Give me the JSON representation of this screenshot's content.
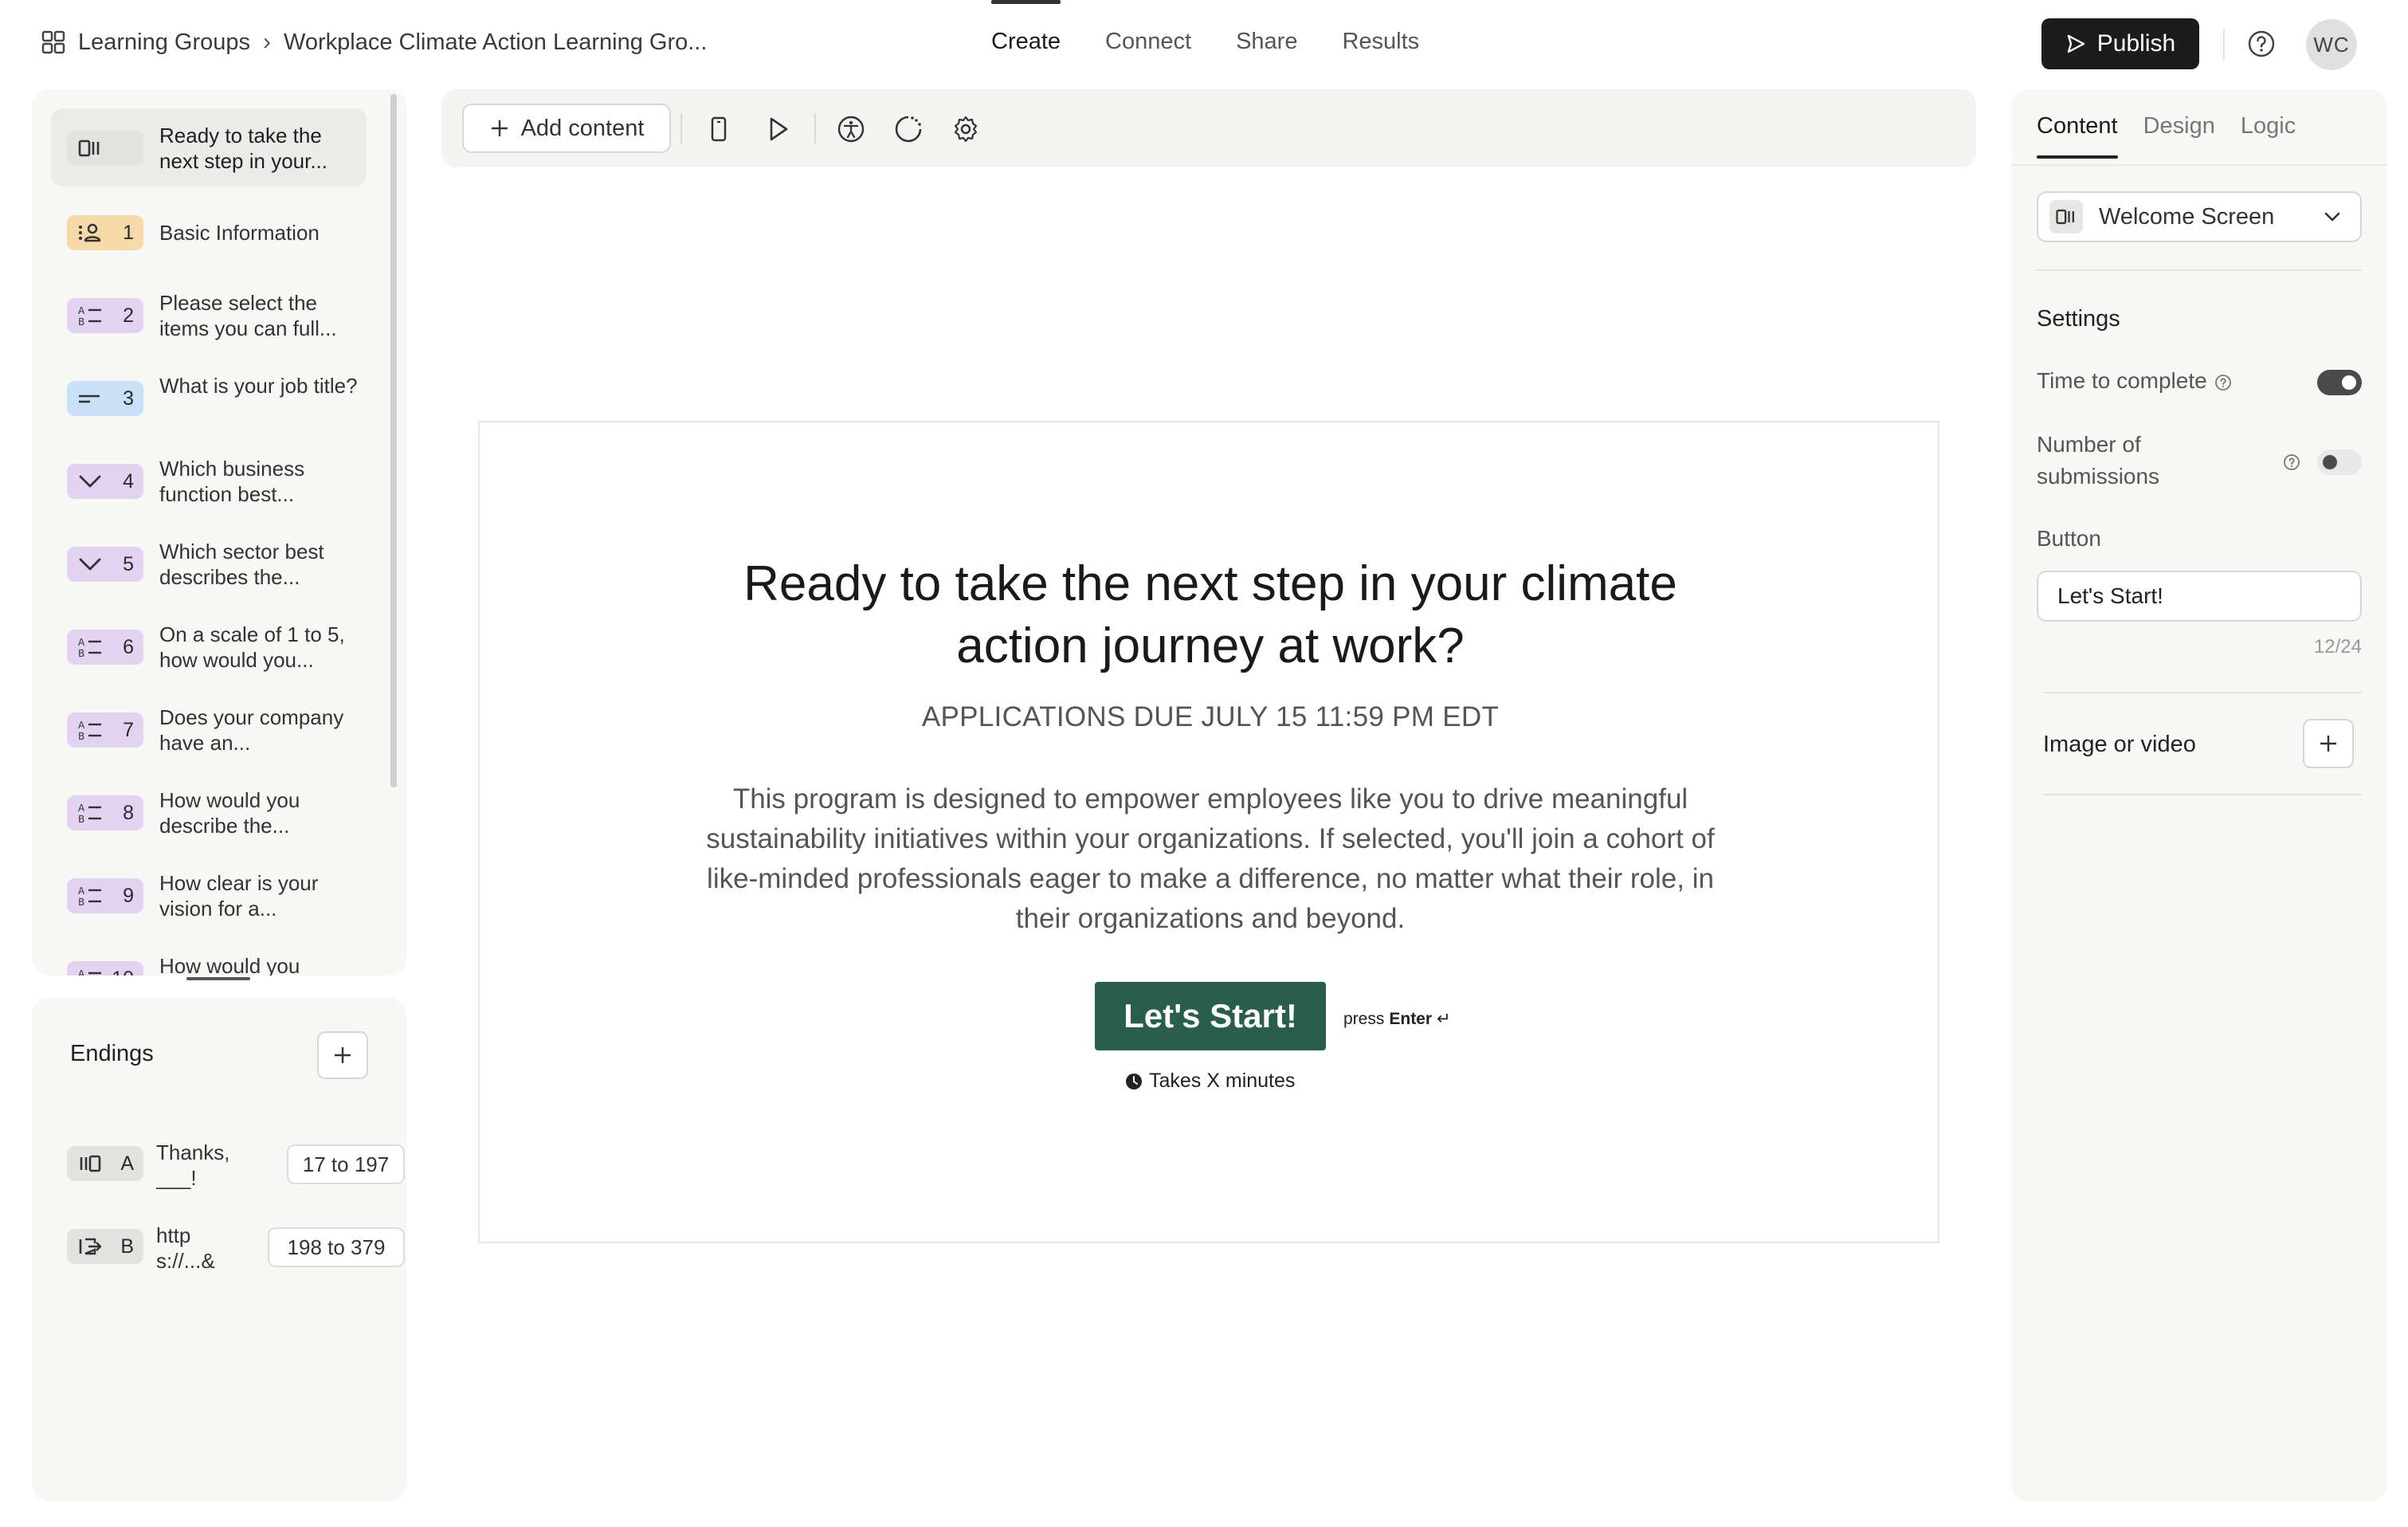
{
  "breadcrumb": {
    "root": "Learning Groups",
    "separator": "›",
    "current": "Workplace Climate Action Learning Gro..."
  },
  "nav": {
    "tabs": [
      {
        "label": "Create",
        "active": true
      },
      {
        "label": "Connect",
        "active": false
      },
      {
        "label": "Share",
        "active": false
      },
      {
        "label": "Results",
        "active": false
      }
    ]
  },
  "header": {
    "publish_label": "Publish",
    "avatar_initials": "WC"
  },
  "sidebar": {
    "questions": [
      {
        "number": "",
        "text": "Ready to take the next step in your...",
        "type": "welcome",
        "color": "#e2e2e0",
        "selected": true
      },
      {
        "number": "1",
        "text": "Basic Information",
        "type": "contact",
        "color": "#f6d9a8"
      },
      {
        "number": "2",
        "text": "Please select the items you can full...",
        "type": "multiple-choice",
        "color": "#e4d2f2"
      },
      {
        "number": "3",
        "text": "What is your job title?",
        "type": "short-text",
        "color": "#c9e0f7"
      },
      {
        "number": "4",
        "text": "Which business function best...",
        "type": "dropdown",
        "color": "#e4d2f2"
      },
      {
        "number": "5",
        "text": "Which sector best describes the...",
        "type": "dropdown",
        "color": "#e4d2f2"
      },
      {
        "number": "6",
        "text": "On a scale of 1 to 5, how would you...",
        "type": "multiple-choice",
        "color": "#e4d2f2"
      },
      {
        "number": "7",
        "text": "Does your company have an...",
        "type": "multiple-choice",
        "color": "#e4d2f2"
      },
      {
        "number": "8",
        "text": "How would you describe the...",
        "type": "multiple-choice",
        "color": "#e4d2f2"
      },
      {
        "number": "9",
        "text": "How clear is your vision for a...",
        "type": "multiple-choice",
        "color": "#e4d2f2"
      },
      {
        "number": "10",
        "text": "How would you",
        "type": "multiple-choice",
        "color": "#e4d2f2"
      }
    ],
    "endings_title": "Endings",
    "endings": [
      {
        "letter": "A",
        "text": "Thanks, ___!",
        "range": "17 to 197",
        "type": "ending"
      },
      {
        "letter": "B",
        "text": "https://...&utm_",
        "range": "198 to 379",
        "type": "redirect"
      }
    ]
  },
  "toolbar": {
    "add_content_label": "Add content",
    "icons": [
      "mobile-preview-icon",
      "play-icon",
      "accessibility-icon",
      "loading-icon",
      "settings-icon"
    ]
  },
  "canvas": {
    "headline": "Ready to take the next step in your climate action journey at work?",
    "subheading": "APPLICATIONS DUE JULY 15 11:59 PM EDT",
    "body": "This program is designed to empower employees like you to drive meaningful sustainability initiatives within your organizations. If selected, you'll join a cohort of like-minded professionals eager to make a difference, no matter what their role, in their organizations and beyond.",
    "button_label": "Let's Start!",
    "press_prefix": "press",
    "press_key": "Enter",
    "press_symbol": "↵",
    "time_hint": "Takes X minutes",
    "button_color": "#2a5e4c"
  },
  "right_panel": {
    "tabs": [
      {
        "label": "Content",
        "active": true
      },
      {
        "label": "Design",
        "active": false
      },
      {
        "label": "Logic",
        "active": false
      }
    ],
    "block_type": "Welcome Screen",
    "settings_title": "Settings",
    "time_to_complete_label": "Time to complete",
    "time_to_complete_on": true,
    "number_of_submissions_label": "Number of submissions",
    "number_of_submissions_on": false,
    "button_section_label": "Button",
    "button_value": "Let's Start!",
    "button_counter": "12/24",
    "image_or_video_label": "Image or video"
  }
}
